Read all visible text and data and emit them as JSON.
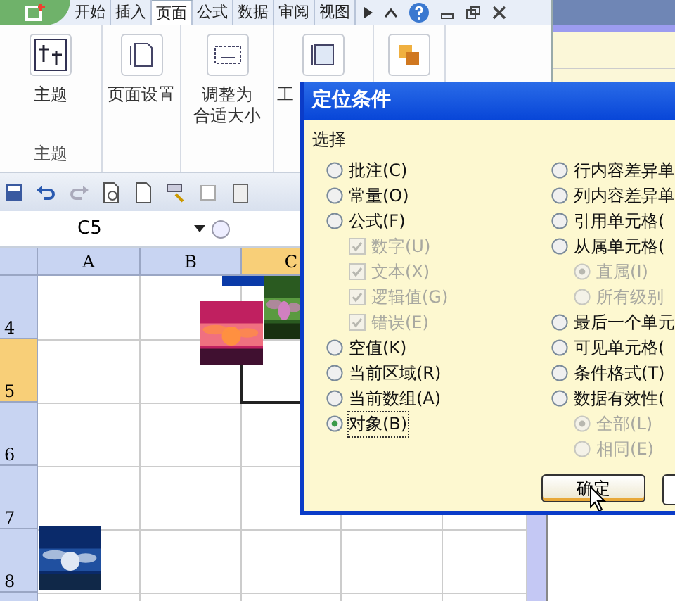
{
  "ribbon": {
    "tabs": [
      {
        "label": "开始",
        "selected": false
      },
      {
        "label": "插入",
        "selected": false
      },
      {
        "label": "页面",
        "selected": true
      },
      {
        "label": "公式",
        "selected": false
      },
      {
        "label": "数据",
        "selected": false
      },
      {
        "label": "审阅",
        "selected": false
      },
      {
        "label": "视图",
        "selected": false
      }
    ],
    "groups": [
      {
        "kind": "theme",
        "button": "主题",
        "caption": "主题"
      },
      {
        "kind": "page",
        "button": "页面设置"
      },
      {
        "kind": "fit",
        "button": "调整为",
        "button_line2": "合适大小"
      },
      {
        "kind": "sheet",
        "button": "工"
      }
    ]
  },
  "name_box": "C5",
  "sheet": {
    "columns": [
      {
        "label": "A",
        "selected": false
      },
      {
        "label": "B",
        "selected": false
      },
      {
        "label": "C",
        "selected": true
      }
    ],
    "rows": [
      {
        "label": "4",
        "selected": false
      },
      {
        "label": "5",
        "selected": true
      },
      {
        "label": "6",
        "selected": false
      },
      {
        "label": "7",
        "selected": false
      },
      {
        "label": "8",
        "selected": false
      }
    ]
  },
  "dialog": {
    "title": "定位条件",
    "group_label": "选择",
    "left_options": [
      {
        "kind": "radio",
        "label": "批注(C)",
        "selected": false,
        "disabled": false
      },
      {
        "kind": "radio",
        "label": "常量(O)",
        "selected": false,
        "disabled": false
      },
      {
        "kind": "radio",
        "label": "公式(F)",
        "selected": false,
        "disabled": false
      },
      {
        "kind": "checkbox",
        "label": "数字(U)",
        "checked": true,
        "disabled": true
      },
      {
        "kind": "checkbox",
        "label": "文本(X)",
        "checked": true,
        "disabled": true
      },
      {
        "kind": "checkbox",
        "label": "逻辑值(G)",
        "checked": true,
        "disabled": true
      },
      {
        "kind": "checkbox",
        "label": "错误(E)",
        "checked": true,
        "disabled": true
      },
      {
        "kind": "radio",
        "label": "空值(K)",
        "selected": false,
        "disabled": false
      },
      {
        "kind": "radio",
        "label": "当前区域(R)",
        "selected": false,
        "disabled": false
      },
      {
        "kind": "radio",
        "label": "当前数组(A)",
        "selected": false,
        "disabled": false
      },
      {
        "kind": "radio",
        "label": "对象(B)",
        "selected": true,
        "disabled": false
      }
    ],
    "right_options": [
      {
        "kind": "radio",
        "label": "行内容差异单",
        "selected": false,
        "disabled": false
      },
      {
        "kind": "radio",
        "label": "列内容差异单",
        "selected": false,
        "disabled": false
      },
      {
        "kind": "radio",
        "label": "引用单元格(",
        "selected": false,
        "disabled": false
      },
      {
        "kind": "radio",
        "label": "从属单元格(",
        "selected": false,
        "disabled": false
      },
      {
        "kind": "subradio",
        "label": "直属(I)",
        "selected": true,
        "disabled": true
      },
      {
        "kind": "subradio",
        "label": "所有级别",
        "selected": false,
        "disabled": true
      },
      {
        "kind": "radio",
        "label": "最后一个单元",
        "selected": false,
        "disabled": false
      },
      {
        "kind": "radio",
        "label": "可见单元格(",
        "selected": false,
        "disabled": false
      },
      {
        "kind": "radio",
        "label": "条件格式(T)",
        "selected": false,
        "disabled": false
      },
      {
        "kind": "radio",
        "label": "数据有效性(",
        "selected": false,
        "disabled": false
      },
      {
        "kind": "subradio",
        "label": "全部(L)",
        "selected": true,
        "disabled": true
      },
      {
        "kind": "subradio",
        "label": "相同(E)",
        "selected": false,
        "disabled": true
      }
    ],
    "ok_button": "确定"
  }
}
